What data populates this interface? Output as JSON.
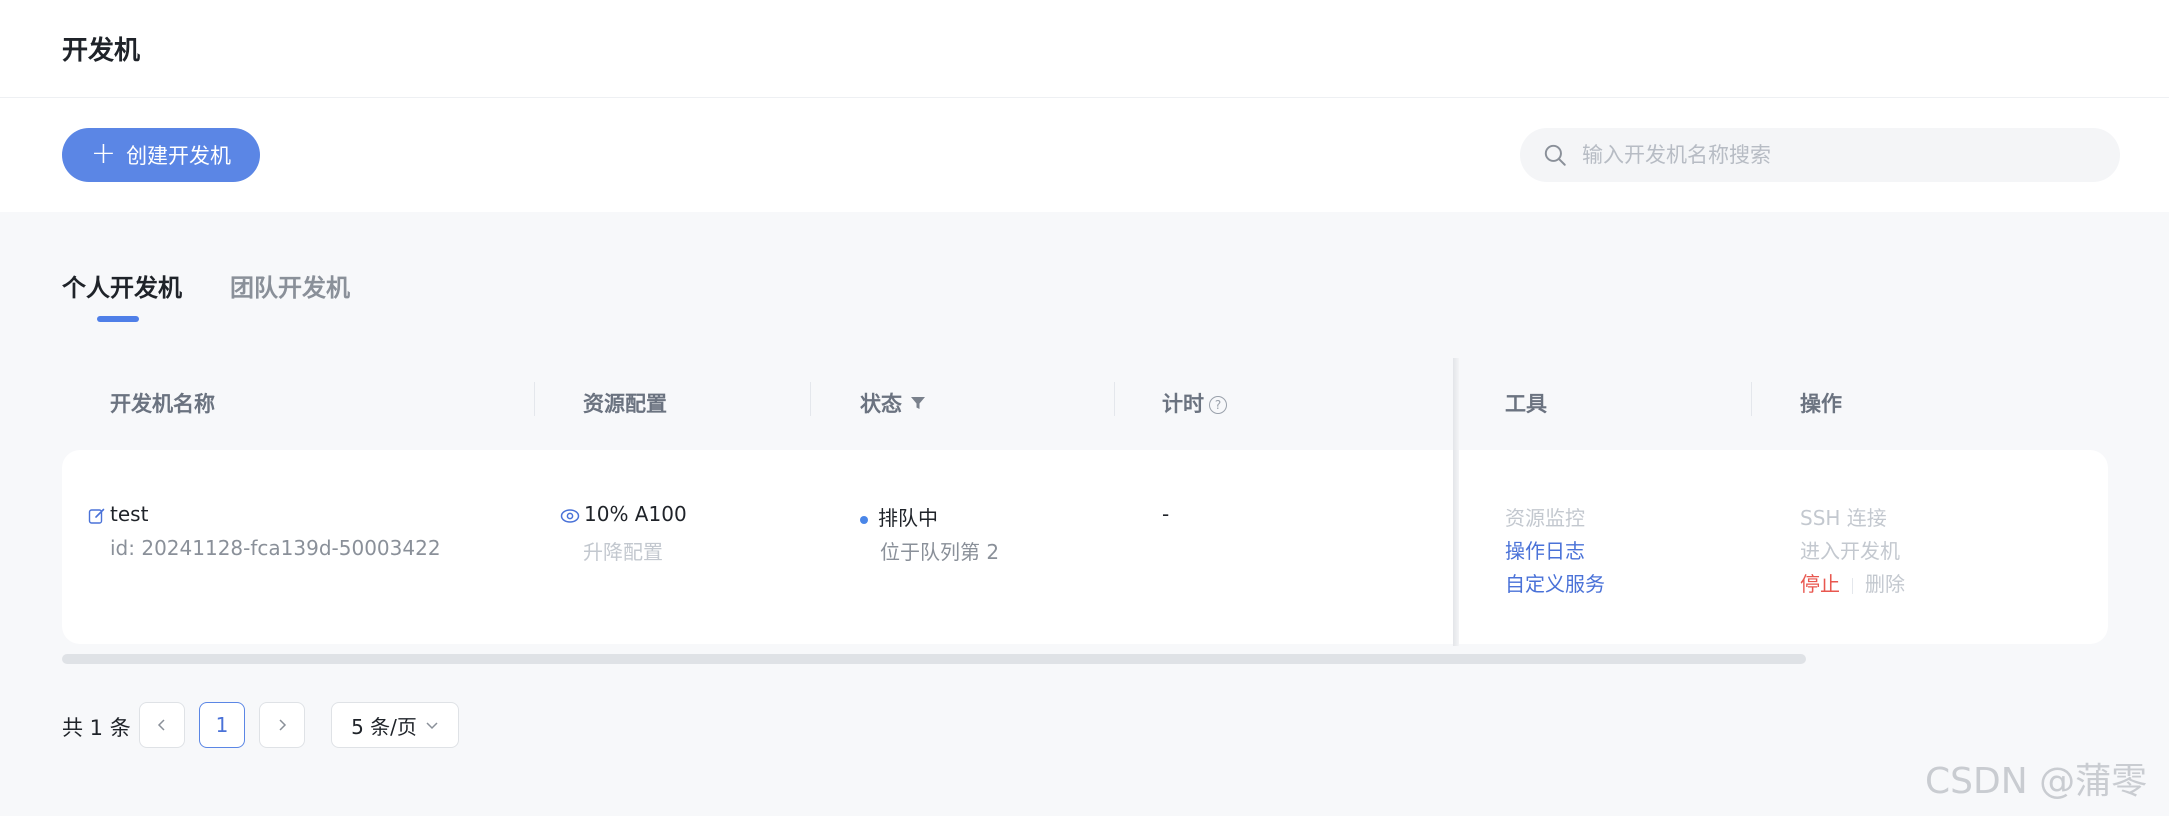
{
  "page": {
    "title": "开发机"
  },
  "toolbar": {
    "create_label": "创建开发机",
    "search_placeholder": "输入开发机名称搜索"
  },
  "tabs": [
    {
      "label": "个人开发机",
      "active": true
    },
    {
      "label": "团队开发机",
      "active": false
    }
  ],
  "table": {
    "columns": [
      "开发机名称",
      "资源配置",
      "状态",
      "计时",
      "工具",
      "操作"
    ],
    "rows": [
      {
        "name": "test",
        "id": "id: 20241128-fca139d-50003422",
        "resource": "10% A100",
        "resource_action": "升降配置",
        "status": "排队中",
        "status_detail": "位于队列第 2",
        "timer": "-",
        "tools": [
          "资源监控",
          "操作日志",
          "自定义服务"
        ],
        "ops": {
          "ssh": "SSH 连接",
          "enter": "进入开发机",
          "stop": "停止",
          "delete": "删除"
        }
      }
    ]
  },
  "pagination": {
    "total": "共 1 条",
    "current_page": "1",
    "page_size": "5 条/页"
  },
  "watermark": "CSDN @蒲零",
  "colors": {
    "primary": "#5b86e5",
    "link": "#4a72d8",
    "danger": "#e8574f"
  }
}
